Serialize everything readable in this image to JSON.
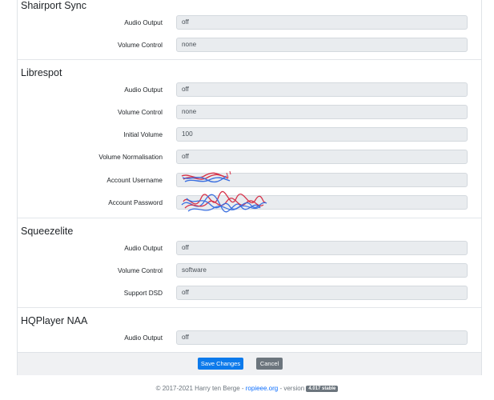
{
  "sections": {
    "shairport": {
      "title": "Shairport Sync",
      "audio_output_label": "Audio Output",
      "audio_output_value": "off",
      "volume_control_label": "Volume Control",
      "volume_control_value": "none"
    },
    "librespot": {
      "title": "Librespot",
      "audio_output_label": "Audio Output",
      "audio_output_value": "off",
      "volume_control_label": "Volume Control",
      "volume_control_value": "none",
      "initial_volume_label": "Initial Volume",
      "initial_volume_value": "100",
      "normalisation_label": "Volume Normalisation",
      "normalisation_value": "off",
      "username_label": "Account Username",
      "password_label": "Account Password"
    },
    "squeezelite": {
      "title": "Squeezelite",
      "audio_output_label": "Audio Output",
      "audio_output_value": "off",
      "volume_control_label": "Volume Control",
      "volume_control_value": "software",
      "support_dsd_label": "Support DSD",
      "support_dsd_value": "off"
    },
    "hqplayer": {
      "title": "HQPlayer NAA",
      "audio_output_label": "Audio Output",
      "audio_output_value": "off"
    }
  },
  "actions": {
    "save_label": "Save Changes",
    "cancel_label": "Cancel"
  },
  "footer": {
    "copyright": "© 2017-2021 Harry ten Berge - ",
    "link": "ropieee.org",
    "version_text": " - version ",
    "badge": "4.017 stable"
  },
  "colors": {
    "primary": "#0d7aeb",
    "secondary": "#6c757d",
    "field_bg": "#e9ecef",
    "scribble_red": "#d6334a",
    "scribble_blue": "#3a6fe0"
  }
}
